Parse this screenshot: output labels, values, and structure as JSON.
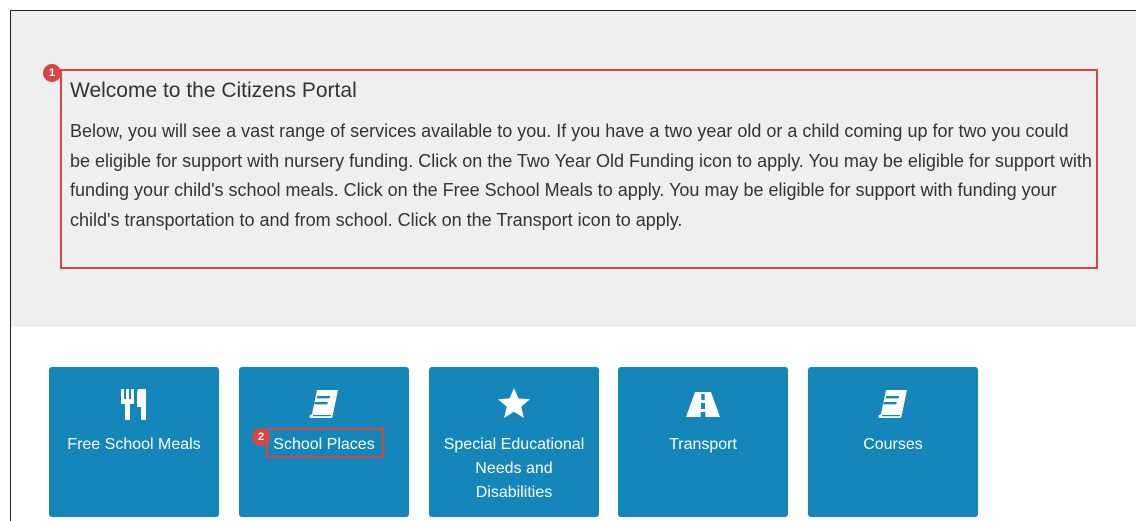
{
  "welcome": {
    "title": "Welcome to the Citizens Portal",
    "body": "Below, you will see a vast range of services available to you. If you have a two year old or a child coming up for two you could be eligible for support with nursery funding. Click on the Two Year Old Funding icon to apply. You may be eligible for support with funding your child's school meals. Click on the Free School Meals to apply. You may be eligible for support with funding your child's transportation to and from school. Click on the Transport icon to apply."
  },
  "markers": [
    "1",
    "2"
  ],
  "tiles": [
    {
      "label": "Free School Meals",
      "icon": "utensils-icon"
    },
    {
      "label": "School Places",
      "icon": "book-icon"
    },
    {
      "label": "Special Educational Needs and Disabilities",
      "icon": "star-icon"
    },
    {
      "label": "Transport",
      "icon": "road-icon"
    },
    {
      "label": "Courses",
      "icon": "book-icon"
    }
  ],
  "colors": {
    "tile": "#1486b9",
    "highlight": "#d9463f",
    "hero": "#efefef"
  }
}
